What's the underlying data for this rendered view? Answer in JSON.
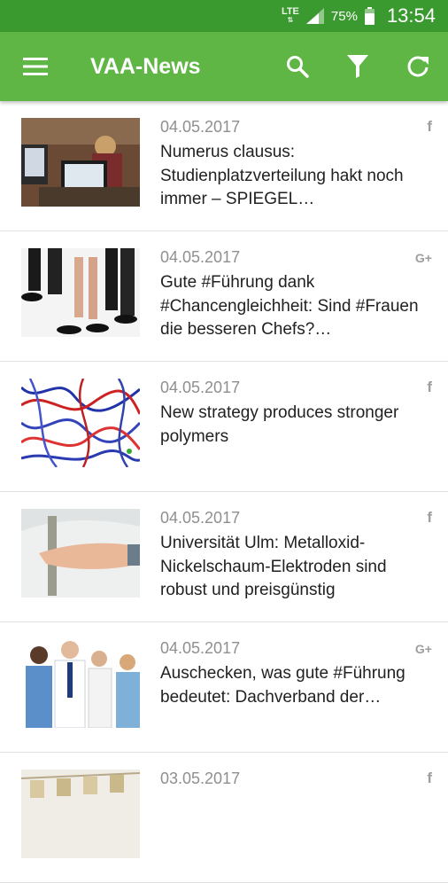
{
  "statusbar": {
    "network": "LTE",
    "battery": "75%",
    "time": "13:54"
  },
  "appbar": {
    "title": "VAA-News",
    "icons": [
      "menu-icon",
      "search-icon",
      "filter-icon",
      "refresh-icon"
    ]
  },
  "colors": {
    "statusbar": "#3b9a2f",
    "appbar": "#5fb645"
  },
  "items": [
    {
      "date": "04.05.2017",
      "headline": "Numerus clausus: Studienplatzverteilung hakt noch immer – SPIEGEL…",
      "source": "f"
    },
    {
      "date": "04.05.2017",
      "headline": "Gute #Führung dank #Chancengleichheit: Sind #Frauen die besseren Chefs?…",
      "source": "G+"
    },
    {
      "date": "04.05.2017",
      "headline": "New strategy produces stronger polymers",
      "source": "f"
    },
    {
      "date": "04.05.2017",
      "headline": "Universität Ulm: Metalloxid-Nickelschaum-Elektroden sind robust und preisgünstig",
      "source": "f"
    },
    {
      "date": "04.05.2017",
      "headline": "Auschecken, was gute #Führung bedeutet: Dachverband der…",
      "source": "G+"
    },
    {
      "date": "03.05.2017",
      "headline": "",
      "source": "f"
    }
  ]
}
